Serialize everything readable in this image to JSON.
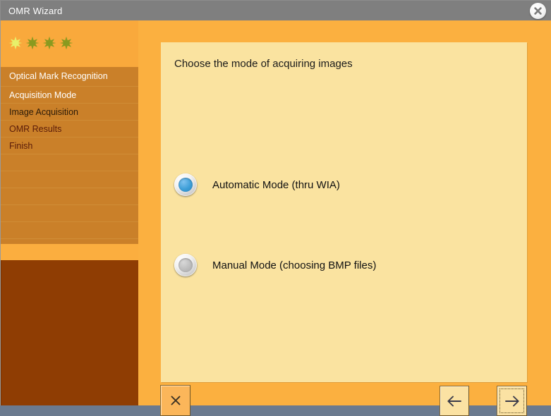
{
  "window": {
    "title": "OMR Wizard",
    "close_icon": "close-circle-icon",
    "titlebar_color": "#7f7f7f",
    "body_color": "#fbb040"
  },
  "sidebar": {
    "stars": [
      {
        "name": "star-1",
        "color": "#e8f06a",
        "active": true
      },
      {
        "name": "star-2",
        "color": "#8a9a1f",
        "active": false
      },
      {
        "name": "star-3",
        "color": "#8a9a1f",
        "active": false
      },
      {
        "name": "star-4",
        "color": "#8a9a1f",
        "active": false
      }
    ],
    "items": [
      {
        "label": "Optical Mark Recognition",
        "style": "header",
        "color_class": "c-white"
      },
      {
        "label": "Acquisition Mode",
        "style": "step",
        "color_class": "c-white"
      },
      {
        "label": "Image Acquisition",
        "style": "step",
        "color_class": "c-dark"
      },
      {
        "label": "OMR Results",
        "style": "step",
        "color_class": "c-maroon"
      },
      {
        "label": "Finish",
        "style": "step",
        "color_class": "c-maroon"
      },
      {
        "label": "",
        "style": "blank",
        "color_class": "c-dark"
      },
      {
        "label": "",
        "style": "blank",
        "color_class": "c-dark"
      },
      {
        "label": "",
        "style": "blank",
        "color_class": "c-dark"
      },
      {
        "label": "",
        "style": "blank",
        "color_class": "c-dark"
      },
      {
        "label": "",
        "style": "blank",
        "color_class": "c-dark"
      },
      {
        "label": "",
        "style": "blank",
        "color_class": "c-dark"
      }
    ],
    "step_color": "#ca8029",
    "footer_color": "#8f3d03"
  },
  "main": {
    "title": "Choose the mode of acquiring images",
    "panel_color": "#fae3a0",
    "options": [
      {
        "label": "Automatic Mode (thru WIA)",
        "selected": true,
        "accent": "#3e9fd8"
      },
      {
        "label": "Manual Mode (choosing BMP files)",
        "selected": false,
        "accent": "#bdbdbd"
      }
    ]
  },
  "footer": {
    "cancel_label": "×",
    "cancel_icon": "close-x-icon",
    "back_label": "←",
    "back_icon": "arrow-left-icon",
    "next_label": "→",
    "next_icon": "arrow-right-icon"
  }
}
